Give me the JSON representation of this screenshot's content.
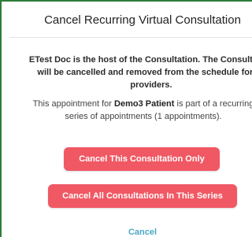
{
  "dialog": {
    "title": "Cancel Recurring Virtual Consultation",
    "host_message": "ETest Doc is the host of the Consultation. The Consultation will be cancelled and removed from the schedule for all providers.",
    "series_prefix": "This appointment for ",
    "patient_name": "Demo3 Patient",
    "series_suffix": " is part of a recurring series of appointments (1 appointments).",
    "buttons": {
      "cancel_this": "Cancel This Consultation Only",
      "cancel_all": "Cancel All Consultations In This Series"
    },
    "cancel_link": "Cancel"
  },
  "colors": {
    "accent_border": "#2e7d3a",
    "button_bg": "#f05863",
    "link": "#4aa8c4"
  }
}
